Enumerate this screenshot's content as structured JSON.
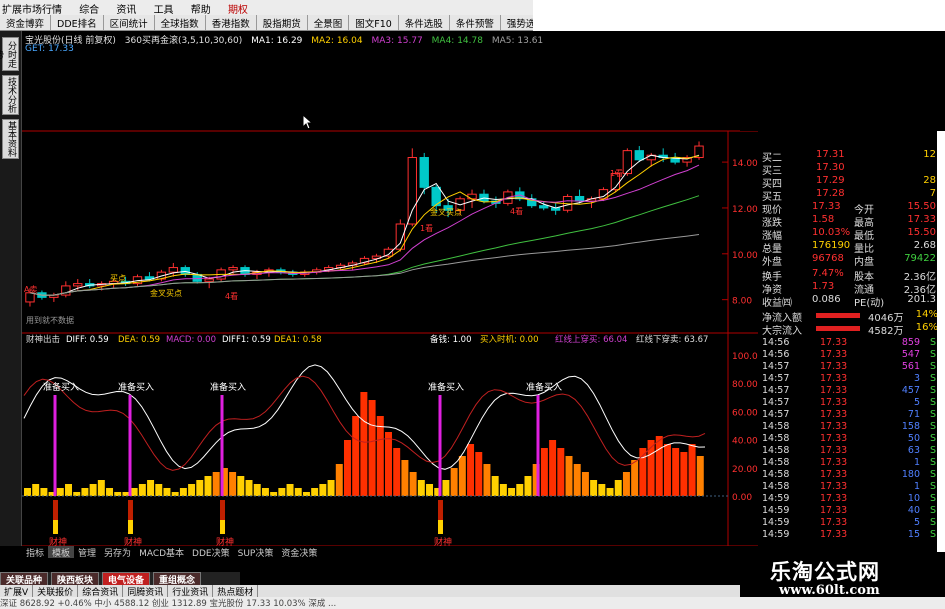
{
  "window": {
    "title_items": [
      "扩展市场行情",
      "综合",
      "资讯",
      "工具",
      "帮助",
      "期权"
    ],
    "active_title": "期权"
  },
  "navbar": [
    "资金博弈",
    "DDE排名",
    "区间统计",
    "全球指数",
    "香港指数",
    "股指期货",
    "全景图",
    "图文F10",
    "条件选股",
    "条件预警",
    "强势选"
  ],
  "sidetabs": [
    "分时走势",
    "技术分析",
    "基本资料"
  ],
  "stock_info": {
    "name": "宝光股份(日线 前复权)",
    "indicator": "360买再金滚(3,5,10,30,60)",
    "ma1": "MA1: 16.29",
    "ma2": "MA2: 16.04",
    "ma3": "MA3: 15.77",
    "ma4": "MA4: 14.78",
    "ma5": "MA5: 13.61",
    "get": "GET: 17.33"
  },
  "price_axis": [
    "14.00",
    "12.00",
    "10.00",
    "8.00"
  ],
  "price_chart": {
    "annotations": [
      "A卖",
      "买点",
      "金叉买点",
      "金叉买点",
      "4看",
      "1看",
      "4看",
      "1看",
      "用到就不数据"
    ],
    "candles": [
      [
        7.9,
        8.5,
        7.7,
        8.3
      ],
      [
        8.3,
        8.4,
        8.0,
        8.1
      ],
      [
        8.1,
        8.3,
        7.9,
        8.2
      ],
      [
        8.2,
        8.8,
        8.1,
        8.6
      ],
      [
        8.6,
        8.9,
        8.4,
        8.7
      ],
      [
        8.7,
        8.9,
        8.5,
        8.6
      ],
      [
        8.6,
        8.8,
        8.4,
        8.7
      ],
      [
        8.7,
        8.9,
        8.5,
        8.8
      ],
      [
        8.8,
        9.0,
        8.6,
        8.7
      ],
      [
        8.7,
        9.1,
        8.6,
        9.0
      ],
      [
        9.0,
        9.2,
        8.8,
        8.9
      ],
      [
        8.9,
        9.3,
        8.8,
        9.2
      ],
      [
        9.2,
        9.6,
        9.0,
        9.4
      ],
      [
        9.4,
        9.5,
        9.0,
        9.1
      ],
      [
        9.1,
        9.2,
        8.7,
        8.8
      ],
      [
        8.8,
        9.0,
        8.5,
        8.9
      ],
      [
        8.9,
        9.4,
        8.8,
        9.3
      ],
      [
        9.3,
        9.5,
        9.1,
        9.4
      ],
      [
        9.4,
        9.5,
        9.0,
        9.1
      ],
      [
        9.1,
        9.3,
        8.9,
        9.2
      ],
      [
        9.2,
        9.4,
        9.0,
        9.3
      ],
      [
        9.3,
        9.4,
        9.1,
        9.2
      ],
      [
        9.2,
        9.3,
        9.0,
        9.1
      ],
      [
        9.1,
        9.3,
        9.0,
        9.2
      ],
      [
        9.2,
        9.4,
        9.1,
        9.3
      ],
      [
        9.3,
        9.5,
        9.2,
        9.4
      ],
      [
        9.4,
        9.6,
        9.3,
        9.5
      ],
      [
        9.5,
        9.7,
        9.3,
        9.6
      ],
      [
        9.6,
        9.9,
        9.5,
        9.8
      ],
      [
        9.8,
        10.0,
        9.6,
        9.9
      ],
      [
        9.9,
        10.3,
        9.8,
        10.2
      ],
      [
        10.2,
        11.5,
        10.1,
        11.3
      ],
      [
        11.3,
        14.6,
        11.2,
        14.2
      ],
      [
        14.2,
        14.4,
        12.6,
        12.9
      ],
      [
        12.9,
        13.0,
        11.8,
        12.1
      ],
      [
        12.1,
        12.4,
        11.6,
        11.9
      ],
      [
        11.9,
        12.5,
        11.7,
        12.4
      ],
      [
        12.4,
        12.8,
        12.0,
        12.6
      ],
      [
        12.6,
        12.8,
        12.2,
        12.3
      ],
      [
        12.3,
        12.5,
        12.0,
        12.2
      ],
      [
        12.2,
        12.8,
        12.1,
        12.7
      ],
      [
        12.7,
        12.9,
        12.3,
        12.4
      ],
      [
        12.4,
        12.6,
        12.0,
        12.1
      ],
      [
        12.1,
        12.3,
        11.9,
        12.0
      ],
      [
        12.0,
        12.2,
        11.7,
        11.9
      ],
      [
        11.9,
        12.6,
        11.8,
        12.5
      ],
      [
        12.5,
        12.8,
        12.2,
        12.3
      ],
      [
        12.3,
        12.5,
        12.0,
        12.4
      ],
      [
        12.4,
        12.9,
        12.3,
        12.8
      ],
      [
        12.8,
        13.6,
        12.7,
        13.5
      ],
      [
        13.5,
        14.6,
        13.4,
        14.5
      ],
      [
        14.5,
        14.7,
        14.0,
        14.1
      ],
      [
        14.1,
        14.4,
        13.8,
        14.3
      ],
      [
        14.3,
        14.6,
        14.0,
        14.2
      ],
      [
        14.2,
        14.4,
        13.9,
        14.0
      ],
      [
        14.0,
        14.3,
        13.8,
        14.2
      ],
      [
        14.2,
        14.9,
        14.1,
        14.7
      ]
    ]
  },
  "indicator_bar": {
    "name": "财神出击",
    "diff": "DIFF: 0.59",
    "dea": "DEA: 0.59",
    "macd": "MACD: 0.00",
    "diff1": "DIFF1: 0.59",
    "dea1": "DEA1: 0.58",
    "bei": "备钱: 1.00",
    "buy": "买入时机: 0.00",
    "red_up": "红线上穿买: 66.04",
    "red_down": "红线下穿卖: 63.67"
  },
  "osc_axis": [
    "100.0",
    "80.00",
    "60.00",
    "40.00",
    "20.00",
    "0.00"
  ],
  "osc_labels": [
    "准备买入",
    "准备买入",
    "准备买入",
    "准备买入",
    "准备买入"
  ],
  "caishen_labels": [
    "财神",
    "财神",
    "财神",
    "财神"
  ],
  "osc_bars": [
    2,
    3,
    2,
    1,
    2,
    3,
    1,
    2,
    3,
    4,
    2,
    1,
    1,
    2,
    3,
    4,
    3,
    2,
    1,
    2,
    3,
    4,
    5,
    6,
    7,
    6,
    5,
    4,
    3,
    2,
    1,
    2,
    3,
    2,
    1,
    2,
    3,
    4,
    8,
    14,
    20,
    26,
    24,
    20,
    16,
    12,
    9,
    6,
    4,
    3,
    2,
    4,
    7,
    10,
    13,
    11,
    8,
    5,
    3,
    2,
    3,
    5,
    8,
    12,
    14,
    12,
    10,
    8,
    6,
    4,
    3,
    2,
    4,
    6,
    9,
    12,
    14,
    15,
    13,
    12,
    11,
    13,
    10
  ],
  "time_axis": [
    "2014年",
    "4",
    "5",
    "2014/05/22/四",
    "12",
    "2",
    "3",
    "4",
    "日线"
  ],
  "quote": {
    "orders": [
      {
        "label": "买二",
        "price": "17.31",
        "vol": "12"
      },
      {
        "label": "买三",
        "price": "17.30",
        "vol": ""
      },
      {
        "label": "买四",
        "price": "17.29",
        "vol": "28"
      },
      {
        "label": "买五",
        "price": "17.28",
        "vol": "7"
      }
    ],
    "stats": [
      {
        "l1": "现价",
        "v1": "17.33",
        "l2": "今开",
        "v2": "15.50"
      },
      {
        "l1": "涨跌",
        "v1": "1.58",
        "l2": "最高",
        "v2": "17.33"
      },
      {
        "l1": "涨幅",
        "v1": "10.03%",
        "l2": "最低",
        "v2": "15.50"
      },
      {
        "l1": "总量",
        "v1": "176190",
        "l2": "量比",
        "v2": "2.68"
      },
      {
        "l1": "外盘",
        "v1": "96768",
        "l2": "内盘",
        "v2": "79422"
      }
    ],
    "stats2": [
      {
        "l1": "换手",
        "v1": "7.47%",
        "l2": "股本",
        "v2": "2.36亿"
      },
      {
        "l1": "净资",
        "v1": "1.73",
        "l2": "流通",
        "v2": "2.36亿"
      },
      {
        "l1": "收益㈣",
        "v1": "0.086",
        "l2": "PE(动)",
        "v2": "201.3"
      }
    ],
    "flows": [
      {
        "label": "净流入额",
        "value": "4046万",
        "pct": "14%"
      },
      {
        "label": "大宗流入",
        "value": "4582万",
        "pct": "16%"
      }
    ],
    "ticks": [
      {
        "t": "14:56",
        "p": "17.33",
        "v": "859",
        "s": "S"
      },
      {
        "t": "14:56",
        "p": "17.33",
        "v": "547",
        "s": "S"
      },
      {
        "t": "14:57",
        "p": "17.33",
        "v": "561",
        "s": "S"
      },
      {
        "t": "14:57",
        "p": "17.33",
        "v": "3",
        "s": "S"
      },
      {
        "t": "14:57",
        "p": "17.33",
        "v": "457",
        "s": "S"
      },
      {
        "t": "14:57",
        "p": "17.33",
        "v": "5",
        "s": "S"
      },
      {
        "t": "14:57",
        "p": "17.33",
        "v": "71",
        "s": "S"
      },
      {
        "t": "14:58",
        "p": "17.33",
        "v": "158",
        "s": "S"
      },
      {
        "t": "14:58",
        "p": "17.33",
        "v": "50",
        "s": "S"
      },
      {
        "t": "14:58",
        "p": "17.33",
        "v": "63",
        "s": "S"
      },
      {
        "t": "14:58",
        "p": "17.33",
        "v": "1",
        "s": "S"
      },
      {
        "t": "14:58",
        "p": "17.33",
        "v": "180",
        "s": "S"
      },
      {
        "t": "14:58",
        "p": "17.33",
        "v": "1",
        "s": "S"
      },
      {
        "t": "14:59",
        "p": "17.33",
        "v": "10",
        "s": "S"
      },
      {
        "t": "14:59",
        "p": "17.33",
        "v": "40",
        "s": "S"
      },
      {
        "t": "14:59",
        "p": "17.33",
        "v": "5",
        "s": "S"
      },
      {
        "t": "14:59",
        "p": "17.33",
        "v": "15",
        "s": "S"
      }
    ]
  },
  "bottom_tabs1": [
    "指标",
    "模板",
    "管理",
    "另存为",
    "MACD基本",
    "DDE决策",
    "SUP决策",
    "资金决策"
  ],
  "bottom_tabs2": [
    "关联品种",
    "陕西板块",
    "电气设备",
    "重组概念"
  ],
  "bottom_tabs3": [
    "扩展V",
    "关联报价",
    "综合资讯",
    "同腾资讯",
    "行业资讯",
    "热点题材"
  ],
  "statusbar": "深证 8628.92 +0.46%  中小 4588.12  创业 1312.89  宝光股份 17.33 10.03%  深成 ...",
  "watermark": {
    "line1": "乐淘公式网",
    "line2": "www.60lt.com"
  },
  "colors": {
    "up": "#ff3030",
    "down": "#00c8c8",
    "ma_yellow": "#ffd000",
    "ma_white": "#ffffff",
    "ma_purple": "#d040d0",
    "ma_green": "#40c040",
    "axis_red": "#b00000"
  }
}
